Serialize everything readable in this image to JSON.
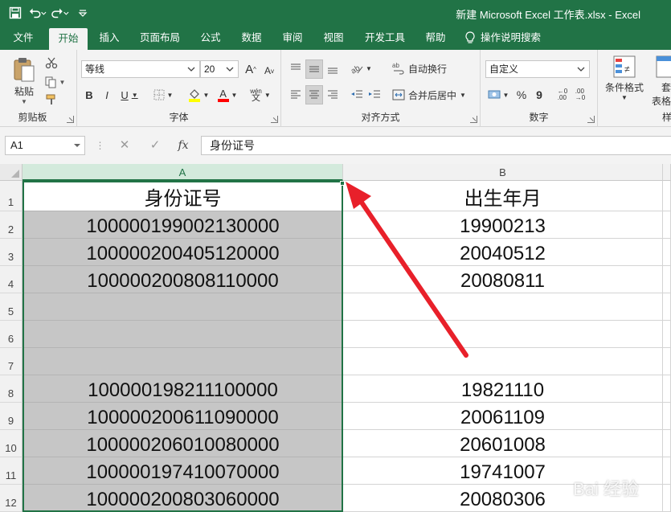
{
  "titlebar": {
    "title": "新建 Microsoft Excel 工作表.xlsx  -  Excel"
  },
  "tabs": [
    "文件",
    "开始",
    "插入",
    "页面布局",
    "公式",
    "数据",
    "审阅",
    "视图",
    "开发工具",
    "帮助",
    "操作说明搜索"
  ],
  "ribbon": {
    "clipboard": {
      "label": "剪贴板",
      "paste": "粘贴"
    },
    "font": {
      "label": "字体",
      "name": "等线",
      "size": "20",
      "bold": "B",
      "italic": "I",
      "underline": "U",
      "font_color_letter": "A",
      "phonetic": "wén"
    },
    "alignment": {
      "label": "对齐方式",
      "wrap": "自动换行",
      "merge": "合并后居中"
    },
    "number": {
      "label": "数字",
      "format": "自定义",
      "percent": "%",
      "comma": "9"
    },
    "styles": {
      "cond_format_1": "条件格式",
      "table_1": "套",
      "table_2": "表格格",
      "cut_label": "样"
    }
  },
  "formula_bar": {
    "name_box": "A1",
    "fx": "fx",
    "content": "身份证号"
  },
  "grid": {
    "columns": [
      "A",
      "B"
    ],
    "row_numbers": [
      "1",
      "2",
      "3",
      "4",
      "5",
      "6",
      "7",
      "8",
      "9",
      "10",
      "11",
      "12"
    ],
    "rows": [
      [
        "身份证号",
        "出生年月"
      ],
      [
        "100000199002130000",
        "19900213"
      ],
      [
        "100000200405120000",
        "20040512"
      ],
      [
        "100000200808110000",
        "20080811"
      ],
      [
        "",
        ""
      ],
      [
        "",
        ""
      ],
      [
        "",
        ""
      ],
      [
        "100000198211100000",
        "19821110"
      ],
      [
        "100000200611090000",
        "20061109"
      ],
      [
        "100000206010080000",
        "20601008"
      ],
      [
        "100000197410070000",
        "19741007"
      ],
      [
        "100000200803060000",
        "20080306"
      ]
    ]
  },
  "watermark": "Bai 经验",
  "colors": {
    "excel_green": "#217346",
    "arrow_red": "#e8202a",
    "selection_gray": "#c6c6c6"
  }
}
